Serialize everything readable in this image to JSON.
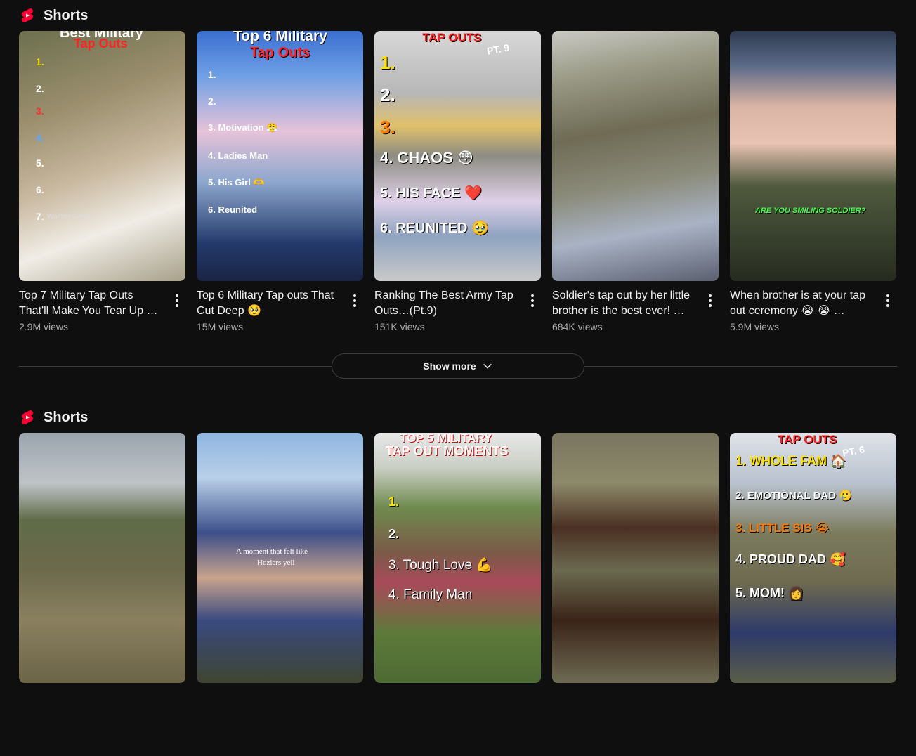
{
  "sections": [
    {
      "title": "Shorts",
      "items": [
        {
          "title": "Top 7 Military Tap Outs That'll Make You Tear Up …",
          "views": "2.9M views",
          "overlay": [
            "Best Military",
            "Tap Outs",
            "1.",
            "2.",
            "3.",
            "4.",
            "5.",
            "6.",
            "7.",
            "Waiting Game"
          ]
        },
        {
          "title": "Top 6 Military Tap outs That Cut Deep 🥺",
          "views": "15M views",
          "overlay": [
            "Top 6 Military",
            "Tap Outs",
            "1.",
            "2.",
            "3. Motivation 😤",
            "4. Ladies Man",
            "5. His Girl 🫶",
            "6. Reunited"
          ]
        },
        {
          "title": "Ranking The Best Army Tap Outs…(Pt.9)",
          "views": "151K views",
          "overlay": [
            "TAP OUTS",
            "PT. 9",
            "1.",
            "2.",
            "3.",
            "4. CHAOS 😳",
            "5. HIS FACE ❤️",
            "6. REUNITED 🥹"
          ]
        },
        {
          "title": "Soldier's tap out by her little brother is the best ever! …",
          "views": "684K views",
          "overlay": []
        },
        {
          "title": "When brother is at your tap out ceremony 😭 😭 …",
          "views": "5.9M views",
          "overlay": [
            "ARE YOU SMILING SOLDIER?"
          ]
        }
      ]
    },
    {
      "title": "Shorts",
      "items": [
        {
          "title": "",
          "views": "",
          "overlay": []
        },
        {
          "title": "",
          "views": "",
          "overlay": [
            "A moment that felt like",
            "Hoziers yell"
          ]
        },
        {
          "title": "",
          "views": "",
          "overlay": [
            "TOP 5 MILITARY",
            "TAP OUT MOMENTS",
            "1.",
            "2.",
            "3. Tough Love 💪",
            "4. Family Man"
          ]
        },
        {
          "title": "",
          "views": "",
          "overlay": []
        },
        {
          "title": "",
          "views": "",
          "overlay": [
            "TAP OUTS",
            "PT. 6",
            "1. WHOLE FAM 🏠",
            "2. EMOTIONAL DAD 🥲",
            "3. LITTLE SIS 😭",
            "4. PROUD DAD 🥰",
            "5. MOM! 👩"
          ]
        }
      ]
    }
  ],
  "show_more": {
    "label": "Show more"
  },
  "icons": {
    "shorts": "shorts-logo-icon",
    "menu": "more-vertical-icon",
    "chevron": "chevron-down-icon"
  },
  "colors": {
    "accent": "#ff0033",
    "background": "#0f0f0f",
    "text": "#f1f1f1",
    "secondary_text": "#aaaaaa"
  }
}
